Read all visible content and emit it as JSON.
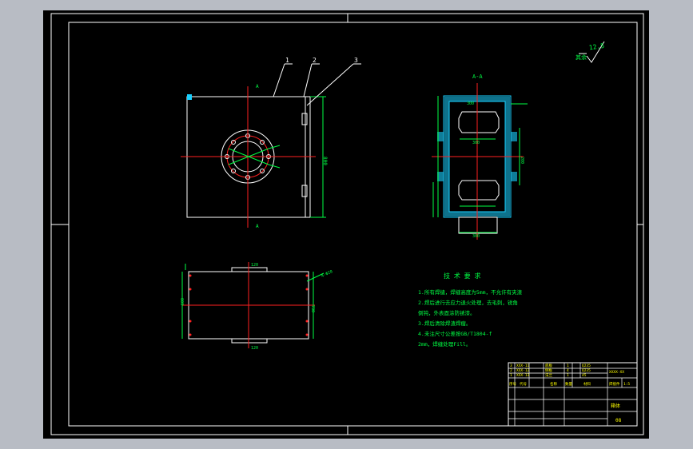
{
  "viewport": {
    "bg": "#b8bcc4",
    "paper": "#000000"
  },
  "colors": {
    "white": "#ffffff",
    "red": "#ff2020",
    "green": "#00ff44",
    "cyan": "#19d0ff",
    "yellow": "#ffff00"
  },
  "roughness": {
    "value": "12.5",
    "label": "其余"
  },
  "balloons": {
    "b1": "1",
    "b2": "2",
    "b3": "3"
  },
  "section_marks": {
    "top": "A",
    "bottom": "A",
    "view": "A-A"
  },
  "front_view": {
    "dim_right": "800"
  },
  "section_view": {
    "dim_top": "300",
    "dim_mid": "300",
    "dim_bottom": "300",
    "dim_right": "200"
  },
  "plan_view": {
    "dim_left": "600",
    "dim_right": "730",
    "dim_top": "120",
    "dim_bottom": "120",
    "dim_diag": "4-Φ20"
  },
  "tech_req": {
    "title": "技 术 要 求",
    "lines": [
      "1.所有焊缝，焊缝高度为5mm，不允许有夹渣",
      "2.焊后进行去应力退火处理，去毛刺，锐角",
      "倒钝，外表面涂防锈漆。",
      "3.焊后清除焊渣焊瘤。",
      "4.未注尺寸公差按GB/T1804-f",
      "2mm，焊缝处理Fill。"
    ]
  },
  "title_block": {
    "rows": [
      [
        "3",
        "XXX-11",
        "底板",
        "1",
        "Q235"
      ],
      [
        "2",
        "XXX-12",
        "侧板",
        "4",
        "Q235"
      ],
      [
        "1",
        "XXX-13",
        "法兰",
        "1",
        "45"
      ]
    ],
    "header": [
      "序号",
      "代号",
      "名称",
      "数量",
      "材料"
    ],
    "drawing_no": "XXXX-XX",
    "name": "箱体",
    "scale": "1:5",
    "sheet": "08",
    "company": "焊接件"
  }
}
